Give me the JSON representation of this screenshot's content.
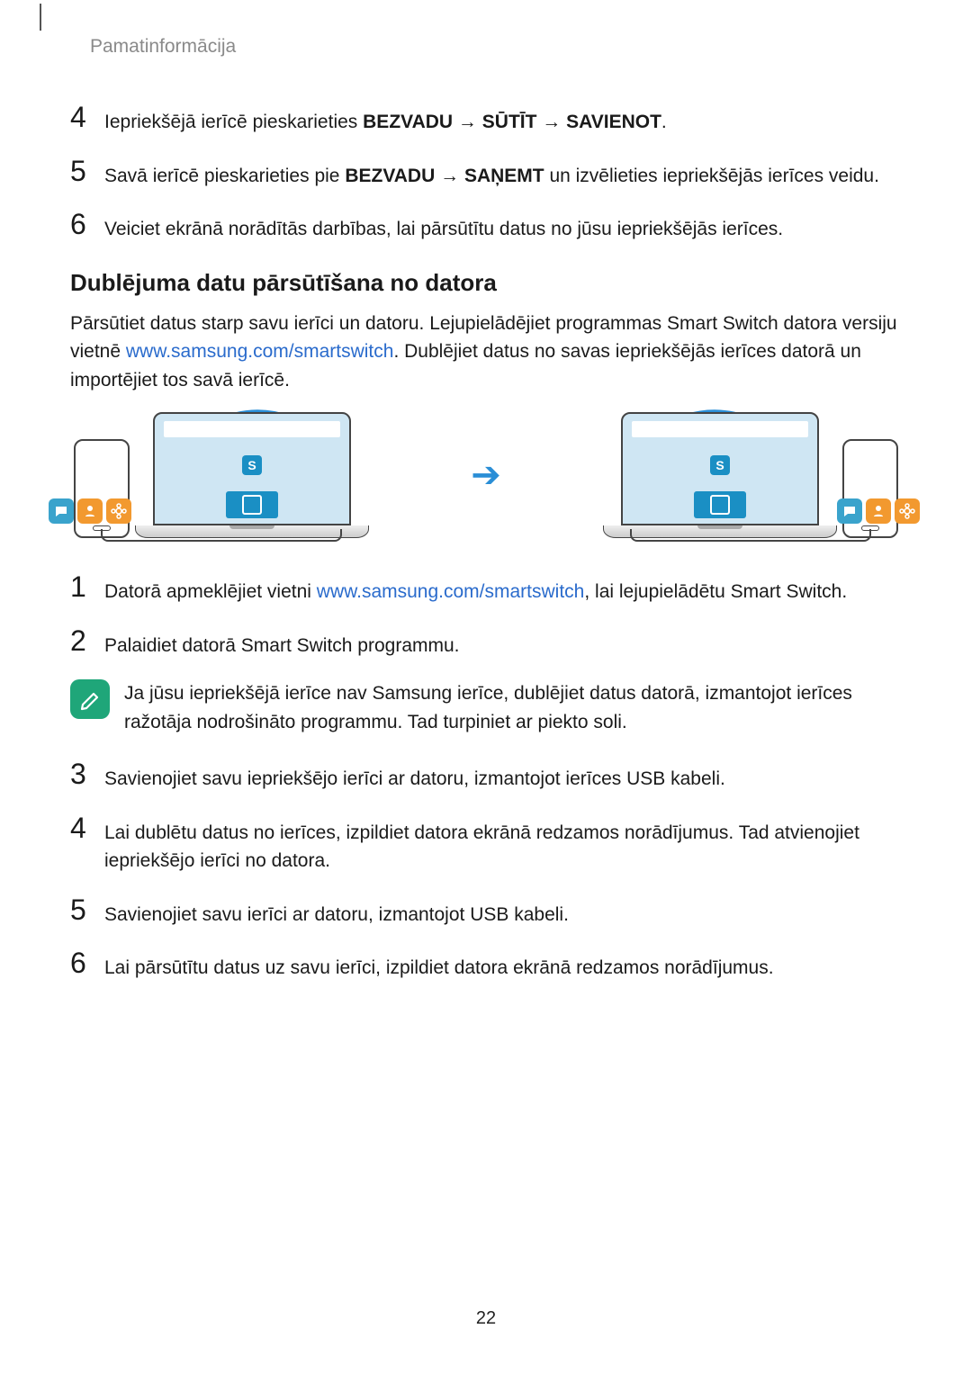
{
  "header": "Pamatinformācija",
  "top_steps": [
    {
      "num": "4",
      "parts": [
        {
          "t": "Iepriekšējā ierīcē pieskarieties "
        },
        {
          "t": "BEZVADU",
          "b": true
        },
        {
          "t": " → "
        },
        {
          "t": "SŪTĪT",
          "b": true
        },
        {
          "t": " → "
        },
        {
          "t": "SAVIENOT",
          "b": true
        },
        {
          "t": "."
        }
      ]
    },
    {
      "num": "5",
      "parts": [
        {
          "t": "Savā ierīcē pieskarieties pie "
        },
        {
          "t": "BEZVADU",
          "b": true
        },
        {
          "t": " → "
        },
        {
          "t": "SAŅEMT",
          "b": true
        },
        {
          "t": " un izvēlieties iepriekšējās ierīces veidu."
        }
      ]
    },
    {
      "num": "6",
      "parts": [
        {
          "t": "Veiciet ekrānā norādītās darbības, lai pārsūtītu datus no jūsu iepriekšējās ierīces."
        }
      ]
    }
  ],
  "section_title": "Dublējuma datu pārsūtīšana no datora",
  "intro_parts": [
    {
      "t": "Pārsūtiet datus starp savu ierīci un datoru. Lejupielādējiet programmas Smart Switch datora versiju vietnē "
    },
    {
      "t": "www.samsung.com/smartswitch",
      "link": true
    },
    {
      "t": ". Dublējiet datus no savas iepriekšējās ierīces datorā un importējiet tos savā ierīcē."
    }
  ],
  "bottom_steps": [
    {
      "num": "1",
      "parts": [
        {
          "t": "Datorā apmeklējiet vietni "
        },
        {
          "t": "www.samsung.com/smartswitch",
          "link": true
        },
        {
          "t": ", lai lejupielādētu Smart Switch."
        }
      ]
    },
    {
      "num": "2",
      "parts": [
        {
          "t": "Palaidiet datorā Smart Switch programmu."
        }
      ]
    }
  ],
  "note_text": "Ja jūsu iepriekšējā ierīce nav Samsung ierīce, dublējiet datus datorā, izmantojot ierīces ražotāja nodrošināto programmu. Tad turpiniet ar piekto soli.",
  "bottom_steps2": [
    {
      "num": "3",
      "parts": [
        {
          "t": "Savienojiet savu iepriekšējo ierīci ar datoru, izmantojot ierīces USB kabeli."
        }
      ]
    },
    {
      "num": "4",
      "parts": [
        {
          "t": "Lai dublētu datus no ierīces, izpildiet datora ekrānā redzamos norādījumus. Tad atvienojiet iepriekšējo ierīci no datora."
        }
      ]
    },
    {
      "num": "5",
      "parts": [
        {
          "t": "Savienojiet savu ierīci ar datoru, izmantojot USB kabeli."
        }
      ]
    },
    {
      "num": "6",
      "parts": [
        {
          "t": "Lai pārsūtītu datus uz savu ierīci, izpildiet datora ekrānā redzamos norādījumus."
        }
      ]
    }
  ],
  "page_number": "22"
}
